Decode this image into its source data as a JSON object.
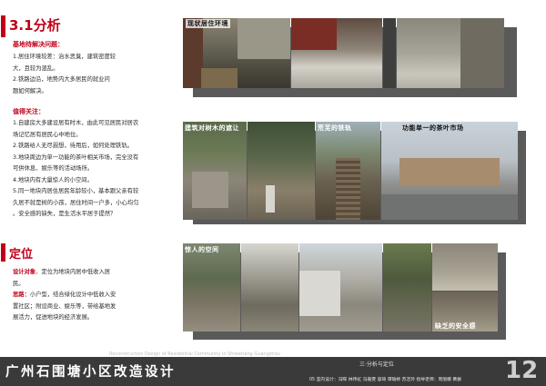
{
  "section1": {
    "title": "3.1分析"
  },
  "problems": {
    "heading": "基地待解决问题：",
    "lines": [
      "1.居住环境较差：治水恶臭，建筑密度较",
      "大，且较为混乱。",
      "2.铁路边沿，地势内大多居民的就业问",
      "题如何解决。"
    ]
  },
  "attention": {
    "heading": "值得关注：",
    "lines": [
      "1.自建房大多建设居有时木，由此可见居民对居农",
      "场记忆居有居民心中地位。",
      "2.铁路给人无尽遐想，待用后，如何处理铁轨。",
      "3.地块周边为单一功能的茶叶相关市场，完全没有",
      "可供休息、娱乐等的活动场所。",
      "4.地块内有大量惊人的小空间。",
      "5.同一地块内居住居民年龄较小，基本跟父亲有较",
      "久居不就是树的小孩，居住时间一户多，小心均匀",
      "。安全感的缺失，是生活水平居于提然？"
    ]
  },
  "section2": {
    "title": "定位"
  },
  "positioning": {
    "line1_label": "设计对象",
    "line1_text": "、定位为地块内居中低收入居",
    "line2_text": "民。",
    "line3_label": "思路：",
    "line3_text": "小户型，结合绿化设计中低收入安",
    "lines": [
      "置社区；附设商业、娱乐等，带给基地发",
      "展活力，促进地块的经济发展。"
    ]
  },
  "captions": {
    "living_env": "现状居住环境",
    "trees": "建筑对树木的遮让",
    "rail": "荒芜的铁轨",
    "market": "功能单一的茶叶市场",
    "space": "惊人的空间",
    "safety": "缺乏的安全感"
  },
  "footer": {
    "title": "广州石围塘小区改造设计",
    "subtitle": "Reconstruction Design of Residential Community in Shiweitang Guangzhou",
    "section": "三·分析与定位",
    "credits": "05 室内设计：冯晖  林伟虹  冯嘉雯  容琦  谭瑜婷  苏洁玲    指导老师：周丽娜  黄群",
    "page": "12"
  },
  "colors": {
    "accent": "#c0001a",
    "footer_bg": "#3a3a3a"
  }
}
